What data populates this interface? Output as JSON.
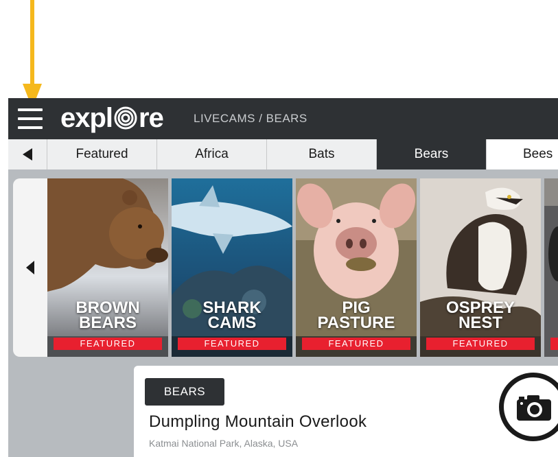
{
  "app": {
    "logo_text_left": "expl",
    "logo_text_right": "re",
    "breadcrumb": "LIVECAMS / BEARS"
  },
  "tabs": [
    {
      "label": "Featured"
    },
    {
      "label": "Africa"
    },
    {
      "label": "Bats"
    },
    {
      "label": "Bears"
    },
    {
      "label": "Bees"
    }
  ],
  "active_tab": "Bears",
  "cards": [
    {
      "line1": "BROWN",
      "line2": "BEARS",
      "badge": "FEATURED"
    },
    {
      "line1": "SHARK",
      "line2": "CAMS",
      "badge": "FEATURED"
    },
    {
      "line1": "PIG",
      "line2": "PASTURE",
      "badge": "FEATURED"
    },
    {
      "line1": "OSPREY",
      "line2": "NEST",
      "badge": "FEATURED"
    }
  ],
  "detail": {
    "category": "BEARS",
    "title": "Dumpling Mountain Overlook",
    "location": "Katmai National Park, Alaska, USA"
  },
  "colors": {
    "topbar": "#2e3134",
    "badge": "#e8202f",
    "annotation_arrow": "#f5b81c"
  },
  "icons": {
    "menu": "hamburger-icon",
    "back": "triangle-left-icon",
    "camera": "camera-icon",
    "annotation": "arrow-down-icon"
  }
}
